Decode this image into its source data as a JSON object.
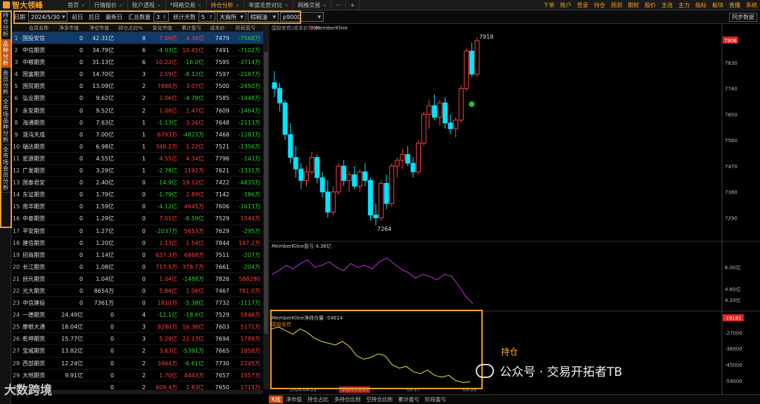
{
  "app": {
    "title": "智大领峰"
  },
  "tabs": [
    "首页",
    "行情报价",
    "账户透视",
    "*网格交易",
    "持仓分析",
    "年度走势对比",
    "网格交易"
  ],
  "active_tab": 4,
  "top_menu": [
    "下单",
    "账户",
    "登录",
    "持仓",
    "预测",
    "期权",
    "报价",
    "主连",
    "主力",
    "指标",
    "板块",
    "直播",
    "系统"
  ],
  "sidebar": [
    "持仓分析",
    "品种分析",
    "会员分析",
    "全市场品种分析",
    "全市场会员分析"
  ],
  "toolbar": {
    "date_label": "日期",
    "date_value": "2024/5/30",
    "prev": "前日",
    "next": "后日",
    "latest": "最新日",
    "sum_label": "汇总数量",
    "sum_value": "3",
    "stat_label": "统计天数",
    "stat_value": "5",
    "exchange": "大商所",
    "variety": "棕榈油",
    "contract": "p9000",
    "sync": "同步数据"
  },
  "table": {
    "columns": [
      "",
      "会员名称",
      "净多市值",
      "净空市值",
      "持仓占比%",
      "变化市值",
      "累计盈亏",
      "成本价",
      "阶段盈亏"
    ],
    "rows": [
      [
        "1",
        "国投安信",
        "0",
        "42.31亿",
        "8",
        "7.09亿",
        "4.36亿",
        "7479",
        "-7568万"
      ],
      [
        "2",
        "中信期货",
        "0",
        "34.79亿",
        "6",
        "-4.93亿",
        "10.45亿",
        "7491",
        "-7102万"
      ],
      [
        "3",
        "中粮期货",
        "0",
        "31.13亿",
        "6",
        "10.22亿",
        "-16.0亿",
        "7595",
        "-3714万"
      ],
      [
        "4",
        "国富期货",
        "0",
        "14.70亿",
        "3",
        "2.59亿",
        "-8.12亿",
        "7597",
        "-2187万"
      ],
      [
        "5",
        "国贸期货",
        "0",
        "13.09亿",
        "2",
        "7888万",
        "3.07亿",
        "7500",
        "-2450万"
      ],
      [
        "6",
        "弘业期货",
        "0",
        "9.62亿",
        "2",
        "2.06亿",
        "-4.78亿",
        "7585",
        "-1448万"
      ],
      [
        "7",
        "永安期货",
        "0",
        "9.52亿",
        "2",
        "1.08亿",
        "1.47亿",
        "7609",
        "-1464万"
      ],
      [
        "8",
        "海通期货",
        "0",
        "7.63亿",
        "1",
        "-1.13亿",
        "3.26亿",
        "7648",
        "-2113万"
      ],
      [
        "9",
        "混沌天成",
        "0",
        "7.00亿",
        "1",
        "6793万",
        "-4823万",
        "7468",
        "-1283万"
      ],
      [
        "10",
        "瑞达期货",
        "0",
        "6.98亿",
        "1",
        "348.2万",
        "1.22亿",
        "7521",
        "-1356万"
      ],
      [
        "11",
        "宏源期货",
        "0",
        "4.55亿",
        "1",
        "4.55亿",
        "4.34亿",
        "7796",
        "-143万"
      ],
      [
        "12",
        "广发期货",
        "0",
        "3.29亿",
        "1",
        "-2.78亿",
        "1192万",
        "7621",
        "-1331万"
      ],
      [
        "13",
        "国泰君安",
        "0",
        "2.40亿",
        "0",
        "-14.9亿",
        "19.12亿",
        "7422",
        "-4835万"
      ],
      [
        "14",
        "东证期货",
        "0",
        "1.79亿",
        "0",
        "-1.79亿",
        "2.89亿",
        "7142",
        "-186万"
      ],
      [
        "15",
        "南华期货",
        "0",
        "1.59亿",
        "0",
        "-4.12亿",
        "4645万",
        "7606",
        "-1613万"
      ],
      [
        "16",
        "中泰期货",
        "0",
        "1.29亿",
        "0",
        "7.01亿",
        "-8.59亿",
        "7529",
        "1544万"
      ],
      [
        "17",
        "平安期货",
        "0",
        "1.27亿",
        "0",
        "-2037万",
        "5653万",
        "7629",
        "-295万"
      ],
      [
        "18",
        "建信期货",
        "0",
        "1.20亿",
        "0",
        "2.13亿",
        "1.54亿",
        "7844",
        "197.2万"
      ],
      [
        "19",
        "招商期货",
        "0",
        "1.14亿",
        "0",
        "637.3万",
        "6868万",
        "7511",
        "-207万"
      ],
      [
        "20",
        "长江期货",
        "0",
        "1.08亿",
        "0",
        "717.5万",
        "378.7万",
        "7661",
        "-204万"
      ],
      [
        "21",
        "创元期货",
        "0",
        "1.04亿",
        "0",
        "1.04亿",
        "-1488万",
        "7826",
        "588280"
      ],
      [
        "22",
        "光大期货",
        "0",
        "8654万",
        "0",
        "5.84亿",
        "1.06亿",
        "7467",
        "781.0万"
      ],
      [
        "23",
        "中信建投",
        "0",
        "7361万",
        "0",
        "1810万",
        "-5.38亿",
        "7732",
        "-1117万"
      ],
      [
        "24",
        "一德期货",
        "24.49亿",
        "0",
        "4",
        "-12.1亿",
        "-18.6亿",
        "7529",
        "5846万"
      ],
      [
        "25",
        "摩根大通",
        "18.04亿",
        "0",
        "3",
        "9280万",
        "16.36亿",
        "7603",
        "5171万"
      ],
      [
        "26",
        "乾坤期货",
        "15.77亿",
        "0",
        "3",
        "5.29亿",
        "22.13亿",
        "7694",
        "1789万"
      ],
      [
        "27",
        "宝城期货",
        "13.82亿",
        "0",
        "2",
        "3.63亿",
        "-5391万",
        "7665",
        "1958万"
      ],
      [
        "28",
        "西部期货",
        "12.24亿",
        "0",
        "2",
        "3464万",
        "-6.61亿",
        "7730",
        "2245万"
      ],
      [
        "29",
        "大地期货",
        "9.91亿",
        "0",
        "2",
        "1.70亿",
        "4443万",
        "7657",
        "1557万"
      ],
      [
        "30",
        "",
        "",
        "0",
        "2",
        "609.4万",
        "1.83亿",
        "7650",
        "1715万"
      ]
    ]
  },
  "chart": {
    "title": "国投安信(成本价均价)",
    "series_label": "MemberKline",
    "price_high_label": "7918",
    "price_low_label": "7264",
    "price_axis": [
      "7830",
      "7740",
      "7650",
      "7560",
      "7470",
      "7380",
      "7290"
    ],
    "price_tag": "7906",
    "pnl_title": "MemberKline盈亏 4.36亿",
    "pnl_axis": [
      "6.00亿",
      "4.80亿",
      "4.20亿"
    ],
    "pos_title": "MemberKline净持仓量 -54614",
    "pos_sub": "国投安信",
    "pos_axis": [
      "-27000",
      "-36000",
      "-45000",
      "-54000"
    ],
    "pos_tag": "-19181",
    "annotation": "持仓",
    "dates": [
      "2024-04-22",
      "2024-05-07",
      "05-17",
      "05-29"
    ],
    "candles": [
      [
        7760,
        7800,
        7710,
        7740
      ],
      [
        7740,
        7760,
        7660,
        7690
      ],
      [
        7690,
        7700,
        7560,
        7580
      ],
      [
        7580,
        7620,
        7480,
        7500
      ],
      [
        7500,
        7540,
        7430,
        7460
      ],
      [
        7460,
        7480,
        7390,
        7420
      ],
      [
        7420,
        7470,
        7400,
        7450
      ],
      [
        7450,
        7520,
        7440,
        7500
      ],
      [
        7500,
        7510,
        7410,
        7430
      ],
      [
        7430,
        7450,
        7360,
        7380
      ],
      [
        7380,
        7420,
        7290,
        7310
      ],
      [
        7310,
        7400,
        7300,
        7380
      ],
      [
        7380,
        7480,
        7370,
        7470
      ],
      [
        7470,
        7490,
        7400,
        7420
      ],
      [
        7420,
        7450,
        7380,
        7440
      ],
      [
        7440,
        7470,
        7390,
        7400
      ],
      [
        7400,
        7460,
        7380,
        7450
      ],
      [
        7450,
        7480,
        7400,
        7420
      ],
      [
        7420,
        7430,
        7280,
        7300
      ],
      [
        7300,
        7340,
        7264,
        7290
      ],
      [
        7290,
        7420,
        7280,
        7410
      ],
      [
        7410,
        7440,
        7320,
        7340
      ],
      [
        7340,
        7480,
        7330,
        7470
      ],
      [
        7470,
        7500,
        7430,
        7490
      ],
      [
        7490,
        7530,
        7460,
        7510
      ],
      [
        7510,
        7540,
        7470,
        7480
      ],
      [
        7480,
        7500,
        7430,
        7450
      ],
      [
        7450,
        7560,
        7440,
        7550
      ],
      [
        7550,
        7660,
        7540,
        7650
      ],
      [
        7650,
        7700,
        7600,
        7680
      ],
      [
        7680,
        7720,
        7630,
        7640
      ],
      [
        7640,
        7700,
        7610,
        7690
      ],
      [
        7690,
        7710,
        7600,
        7620
      ],
      [
        7620,
        7650,
        7580,
        7600
      ],
      [
        7600,
        7640,
        7570,
        7630
      ],
      [
        7630,
        7750,
        7620,
        7740
      ],
      [
        7740,
        7880,
        7730,
        7870
      ],
      [
        7870,
        7900,
        7780,
        7790
      ],
      [
        7790,
        7918,
        7780,
        7906
      ]
    ],
    "pnl_series": [
      5.6,
      5.8,
      6.1,
      5.9,
      6.2,
      6.4,
      6.0,
      6.1,
      6.3,
      6.0,
      5.8,
      6.2,
      6.0,
      6.1,
      5.9,
      6.3,
      6.5,
      6.2,
      5.9,
      5.7,
      5.4,
      5.6,
      5.5,
      5.3,
      5.6,
      5.5,
      5.0,
      4.4,
      4.0
    ],
    "pos_series": [
      -25000,
      -24000,
      -26000,
      -28000,
      -25000,
      -27000,
      -30000,
      -32000,
      -33000,
      -34000,
      -32000,
      -35000,
      -40000,
      -42000,
      -41000,
      -39000,
      -40000,
      -45000,
      -47000,
      -46000,
      -49000,
      -50000,
      -48000,
      -51000,
      -52000,
      -51000,
      -54000,
      -55000,
      -54614
    ]
  },
  "bottom_tabs": [
    "K线",
    "净市值",
    "持仓占比",
    "多持仓比例",
    "空持仓比例",
    "累计盈亏",
    "阶段盈亏"
  ],
  "watermark_left": "大数跨境",
  "watermark_right": "公众号 · 交易开拓者TB"
}
